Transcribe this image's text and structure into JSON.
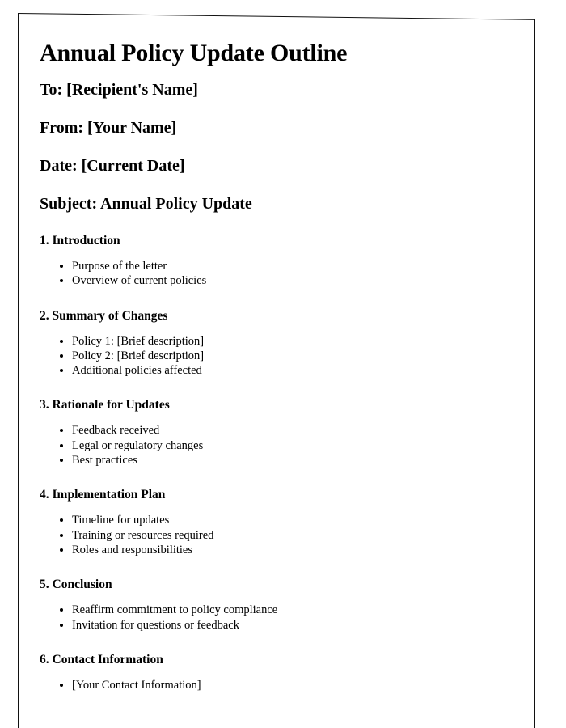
{
  "document": {
    "title": "Annual Policy Update Outline",
    "fields": [
      {
        "label": "To: [Recipient's Name]"
      },
      {
        "label": "From: [Your Name]"
      },
      {
        "label": "Date: [Current Date]"
      },
      {
        "label": "Subject: Annual Policy Update"
      }
    ],
    "sections": [
      {
        "heading": "1. Introduction",
        "items": [
          "Purpose of the letter",
          "Overview of current policies"
        ]
      },
      {
        "heading": "2. Summary of Changes",
        "items": [
          "Policy 1: [Brief description]",
          "Policy 2: [Brief description]",
          "Additional policies affected"
        ]
      },
      {
        "heading": "3. Rationale for Updates",
        "items": [
          "Feedback received",
          "Legal or regulatory changes",
          "Best practices"
        ]
      },
      {
        "heading": "4. Implementation Plan",
        "items": [
          "Timeline for updates",
          "Training or resources required",
          "Roles and responsibilities"
        ]
      },
      {
        "heading": "5. Conclusion",
        "items": [
          "Reaffirm commitment to policy compliance",
          "Invitation for questions or feedback"
        ]
      },
      {
        "heading": "6. Contact Information",
        "items": [
          "[Your Contact Information]"
        ]
      }
    ]
  }
}
